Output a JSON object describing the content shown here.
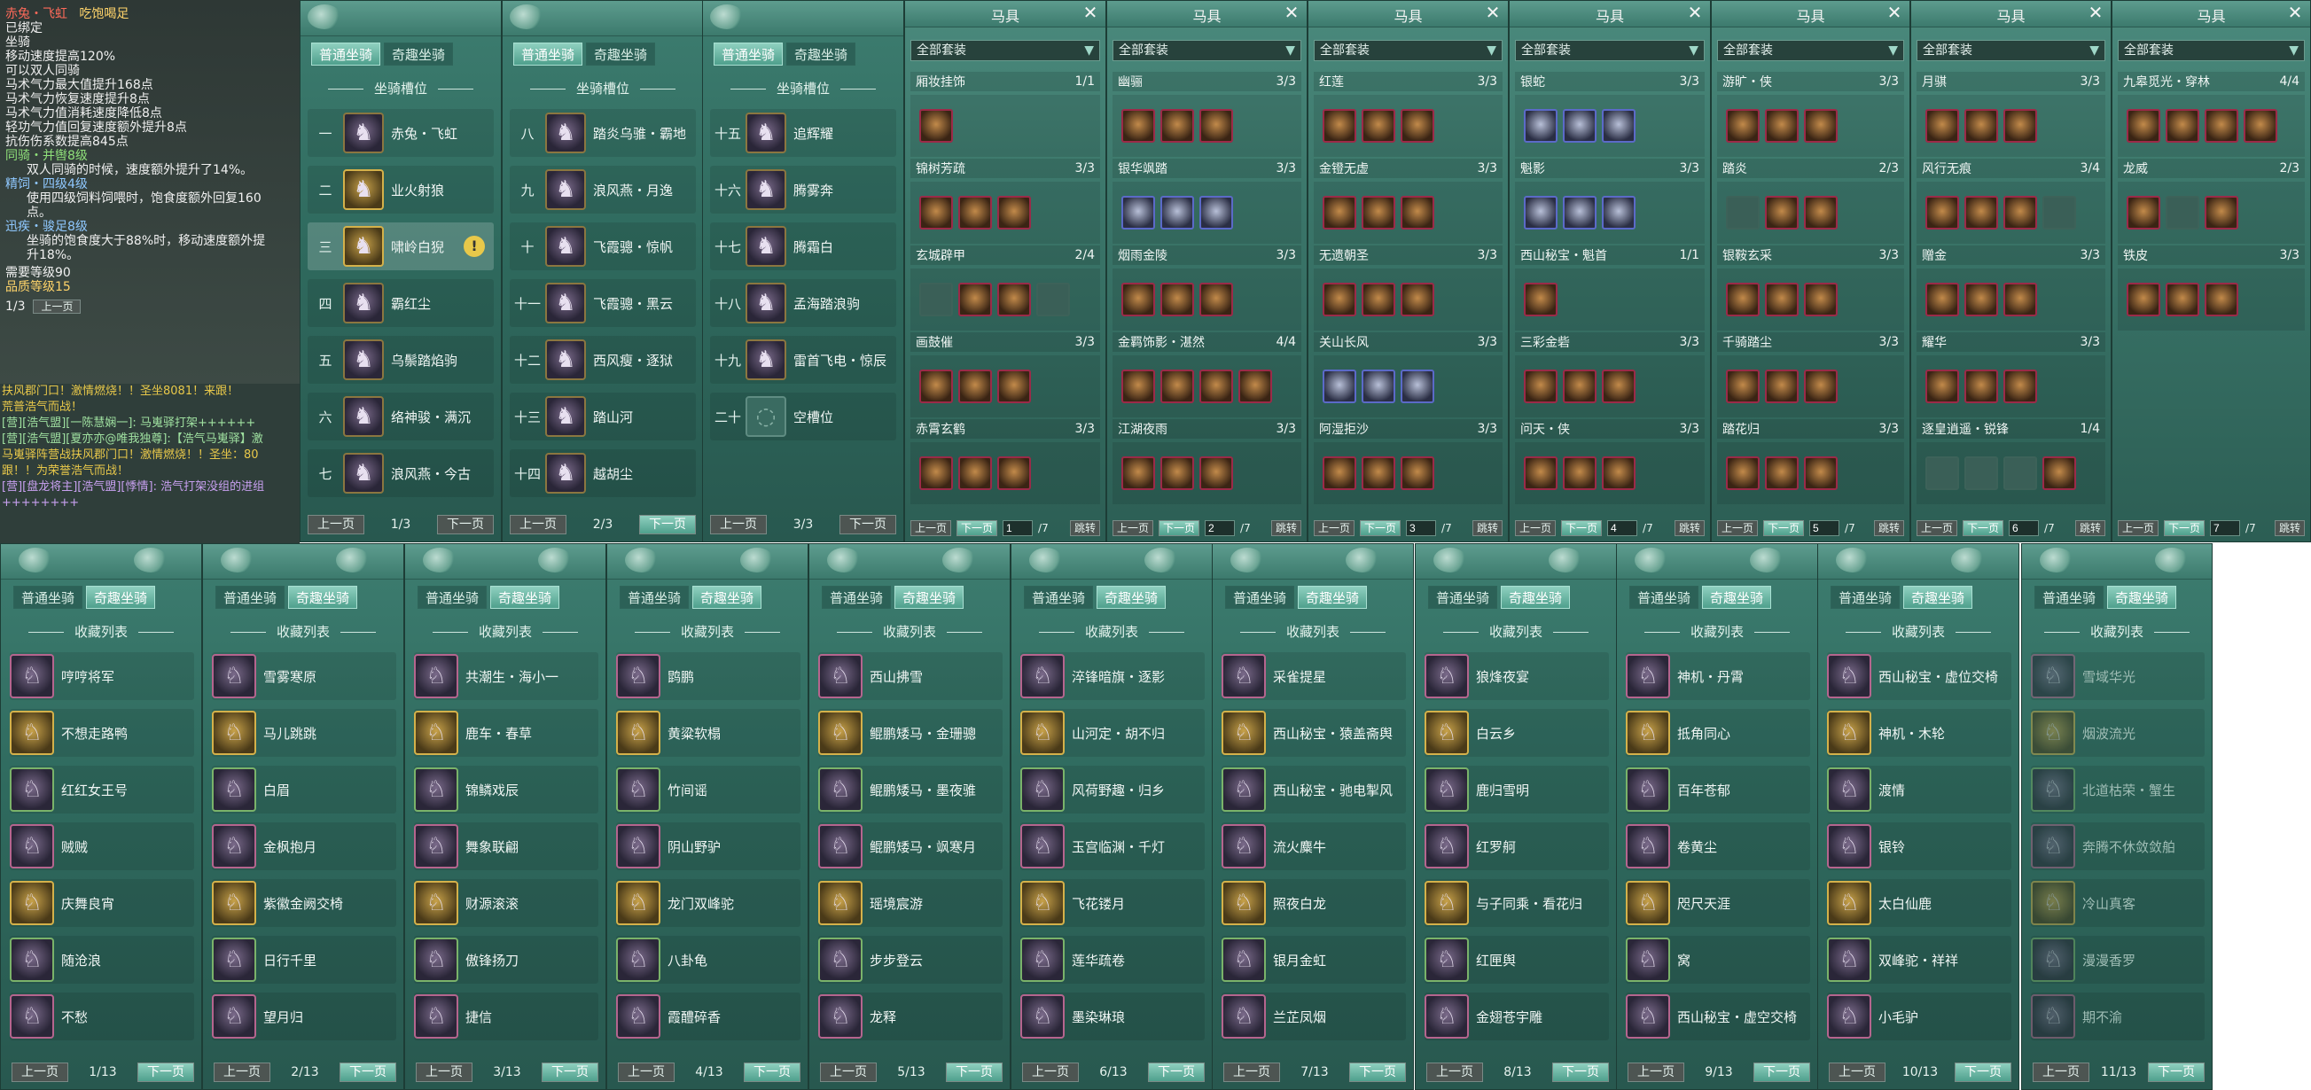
{
  "tooltip": {
    "name": "赤兔・飞虹",
    "name_note": "吃饱喝足",
    "lines": [
      "已绑定",
      "坐骑",
      "移动速度提高120%",
      "可以双人同骑",
      "马术气力最大值提升168点",
      "马术气力恢复速度提升8点",
      "马术气力值消耗速度降低8点",
      "轻功气力值回复速度额外提升8点",
      "抗伤伤系数提高845点"
    ],
    "ride_label": "同骑・并辔8级",
    "ride_desc": "双人同骑的时候，速度额外提升了14%。",
    "feed_label": "精饲・四级4级",
    "feed_desc": [
      "使用四级饲料饲喂时，饱食度额外回复160",
      "点。"
    ],
    "sprint_label": "迅疾・骏足8级",
    "sprint_desc": [
      "坐骑的饱食度大于88%时，移动速度额外提",
      "升18%。"
    ],
    "req_level": "需要等级90",
    "quality": "品质等级15",
    "page": "1/3",
    "page_btn": "上一页"
  },
  "chat": [
    "扶风郡门口！激情燃烧！！圣坐8081！来跟！",
    "荒普浩气而战！",
    "[营][浩气盟][一陈慧娴一]: 马嵬驿打架++++++",
    "[营][浩气盟][夏亦亦@唯我独尊]:【浩气马嵬驿】激",
    "马嵬驿阵营战扶风郡门口！激情燃烧！！圣坐：80",
    "跟！！为荣誉浩气而战！",
    "[营][盘龙将主][浩气盟][悸情]: 浩气打架没组的进组",
    "++++++++"
  ],
  "mount_tabs": {
    "normal": "普通坐骑",
    "fun": "奇趣坐骑"
  },
  "slot_title": "坐骑槽位",
  "slot_panels": [
    {
      "page": "1/3",
      "rows": [
        {
          "num": "一",
          "name": "赤兔・飞虹"
        },
        {
          "num": "二",
          "name": "业火射狼"
        },
        {
          "num": "三",
          "name": "啸岭白猊"
        },
        {
          "num": "四",
          "name": "霸红尘"
        },
        {
          "num": "五",
          "name": "乌鬃踏焰驹"
        },
        {
          "num": "六",
          "name": "络神骏・满沉"
        },
        {
          "num": "七",
          "name": "浪风燕・今古"
        }
      ]
    },
    {
      "page": "2/3",
      "rows": [
        {
          "num": "八",
          "name": "踏炎乌骓・霸地"
        },
        {
          "num": "九",
          "name": "浪风燕・月逸"
        },
        {
          "num": "十",
          "name": "飞霞骢・惊帆"
        },
        {
          "num": "十一",
          "name": "飞霞骢・黑云"
        },
        {
          "num": "十二",
          "name": "西风瘦・逐狱"
        },
        {
          "num": "十三",
          "name": "踏山河"
        },
        {
          "num": "十四",
          "name": "越胡尘"
        }
      ]
    },
    {
      "page": "3/3",
      "rows": [
        {
          "num": "十五",
          "name": "追辉耀"
        },
        {
          "num": "十六",
          "name": "腾雾奔"
        },
        {
          "num": "十七",
          "name": "腾霜白"
        },
        {
          "num": "十八",
          "name": "孟海踏浪驹"
        },
        {
          "num": "十九",
          "name": "雷首飞电・惊辰"
        },
        {
          "num": "二十",
          "name": "空槽位"
        }
      ]
    }
  ],
  "prev": "上一页",
  "next": "下一页",
  "jump": "跳转",
  "harness_title": "马具",
  "filter": "全部套装",
  "harness_panels": [
    {
      "page": "1",
      "total": "/7",
      "sets": [
        {
          "name": "厢妆挂饰",
          "count": "1/1",
          "n": 1
        },
        {
          "name": "锦树芳疏",
          "count": "3/3",
          "n": 3
        },
        {
          "name": "玄城辟甲",
          "count": "2/4",
          "n": 4,
          "ph": [
            0,
            3
          ]
        },
        {
          "name": "画鼓催",
          "count": "3/3",
          "n": 3
        },
        {
          "name": "赤霄玄鹤",
          "count": "3/3",
          "n": 3
        }
      ]
    },
    {
      "page": "2",
      "total": "/7",
      "sets": [
        {
          "name": "幽骊",
          "count": "3/3",
          "n": 3
        },
        {
          "name": "银华飒踏",
          "count": "3/3",
          "n": 3,
          "blue": 1
        },
        {
          "name": "烟雨金陵",
          "count": "3/3",
          "n": 3
        },
        {
          "name": "金羁饰影・湛然",
          "count": "4/4",
          "n": 4
        },
        {
          "name": "江湖夜雨",
          "count": "3/3",
          "n": 3
        }
      ]
    },
    {
      "page": "3",
      "total": "/7",
      "sets": [
        {
          "name": "红莲",
          "count": "3/3",
          "n": 3
        },
        {
          "name": "金镫无虚",
          "count": "3/3",
          "n": 3
        },
        {
          "name": "无遗朝圣",
          "count": "3/3",
          "n": 3
        },
        {
          "name": "关山长风",
          "count": "3/3",
          "n": 3,
          "blue": 1
        },
        {
          "name": "阿湿拒沙",
          "count": "3/3",
          "n": 3
        }
      ]
    },
    {
      "page": "4",
      "total": "/7",
      "sets": [
        {
          "name": "银蛇",
          "count": "3/3",
          "n": 3,
          "blue": 1
        },
        {
          "name": "魁影",
          "count": "3/3",
          "n": 3,
          "blue": 1
        },
        {
          "name": "西山秘宝・魁首",
          "count": "1/1",
          "n": 1
        },
        {
          "name": "三彩金砦",
          "count": "3/3",
          "n": 3
        },
        {
          "name": "问天・侠",
          "count": "3/3",
          "n": 3
        }
      ]
    },
    {
      "page": "5",
      "total": "/7",
      "sets": [
        {
          "name": "游旷・侠",
          "count": "3/3",
          "n": 3
        },
        {
          "name": "踏炎",
          "count": "2/3",
          "n": 3,
          "ph": [
            0
          ]
        },
        {
          "name": "银鞍玄采",
          "count": "3/3",
          "n": 3
        },
        {
          "name": "千骑踏尘",
          "count": "3/3",
          "n": 3
        },
        {
          "name": "踏花归",
          "count": "3/3",
          "n": 3
        }
      ]
    },
    {
      "page": "6",
      "total": "/7",
      "sets": [
        {
          "name": "月骐",
          "count": "3/3",
          "n": 3
        },
        {
          "name": "风行无痕",
          "count": "3/4",
          "n": 4,
          "ph": [
            3
          ]
        },
        {
          "name": "赠金",
          "count": "3/3",
          "n": 3
        },
        {
          "name": "耀华",
          "count": "3/3",
          "n": 3
        },
        {
          "name": "逐皇逍遥・锐锋",
          "count": "1/4",
          "n": 4,
          "ph": [
            0,
            1,
            2
          ]
        }
      ]
    },
    {
      "page": "7",
      "total": "/7",
      "sets": [
        {
          "name": "九皋觅光・穿林",
          "count": "4/4",
          "n": 4
        },
        {
          "name": "龙威",
          "count": "2/3",
          "n": 3,
          "ph": [
            1
          ]
        },
        {
          "name": "铁皮",
          "count": "3/3",
          "n": 3
        }
      ]
    }
  ],
  "fav_title": "收藏列表",
  "fav_panels": [
    {
      "page": "1/13",
      "items": [
        "哼哼将军",
        "不想走路鸭",
        "红红女王号",
        "贼贼",
        "庆舞良宵",
        "随沧浪",
        "不愁"
      ]
    },
    {
      "page": "2/13",
      "items": [
        "雪雾寒原",
        "马儿跳跳",
        "白眉",
        "金枫抱月",
        "紫徽金阙交椅",
        "日行千里",
        "望月归"
      ]
    },
    {
      "page": "3/13",
      "items": [
        "共潮生・海小一",
        "鹿车・春草",
        "锦鳞戏辰",
        "舞象联翩",
        "财源滚滚",
        "傲锋扬刀",
        "捷信"
      ]
    },
    {
      "page": "4/13",
      "items": [
        "鹍鹏",
        "黄粱软榻",
        "竹间谣",
        "阴山野驴",
        "龙门双峰驼",
        "八卦龟",
        "霞醴碎香"
      ]
    },
    {
      "page": "5/13",
      "items": [
        "西山拂雪",
        "鲲鹏矮马・金珊骢",
        "鲲鹏矮马・墨夜骓",
        "鲲鹏矮马・飒寒月",
        "瑶境宸游",
        "步步登云",
        "龙释"
      ]
    },
    {
      "page": "6/13",
      "items": [
        "淬锋暗旗・逐影",
        "山河定・胡不归",
        "风荷野趣・归乡",
        "玉宫临渊・千灯",
        "飞花镂月",
        "莲华疏卷",
        "墨染琳琅"
      ]
    },
    {
      "page": "7/13",
      "items": [
        "采雀提星",
        "西山秘宝・猿盖斋舆",
        "西山秘宝・驰电掣风",
        "流火麋牛",
        "照夜白龙",
        "银月金虹",
        "兰芷凤烟"
      ]
    },
    {
      "page": "8/13",
      "items": [
        "狼烽夜宴",
        "白云乡",
        "鹿归雪明",
        "红罗舸",
        "与子同乘・看花归",
        "红匣舆",
        "金翅苍宇雕"
      ]
    },
    {
      "page": "9/13",
      "items": [
        "神机・丹霄",
        "抵角同心",
        "百年苍郁",
        "卷黄尘",
        "咫尺天涯",
        "窝",
        "西山秘宝・虚空交椅"
      ]
    },
    {
      "page": "10/13",
      "items": [
        "西山秘宝・虚位交椅",
        "神机・木轮",
        "渡情",
        "银铃",
        "太白仙鹿",
        "双峰驼・祥祥",
        "小毛驴"
      ]
    },
    {
      "page": "11/13",
      "items": [
        "雪域华光",
        "烟波流光",
        "北道枯荣・蟹生",
        "奔腾不休敛敛舶",
        "冷山真客",
        "漫漫香罗",
        "期不渝"
      ],
      "dim": true
    }
  ],
  "colors": {
    "panel": "#3d7d70",
    "accent": "#8fd0bf",
    "tooltip_name": "#ff6a5a"
  }
}
